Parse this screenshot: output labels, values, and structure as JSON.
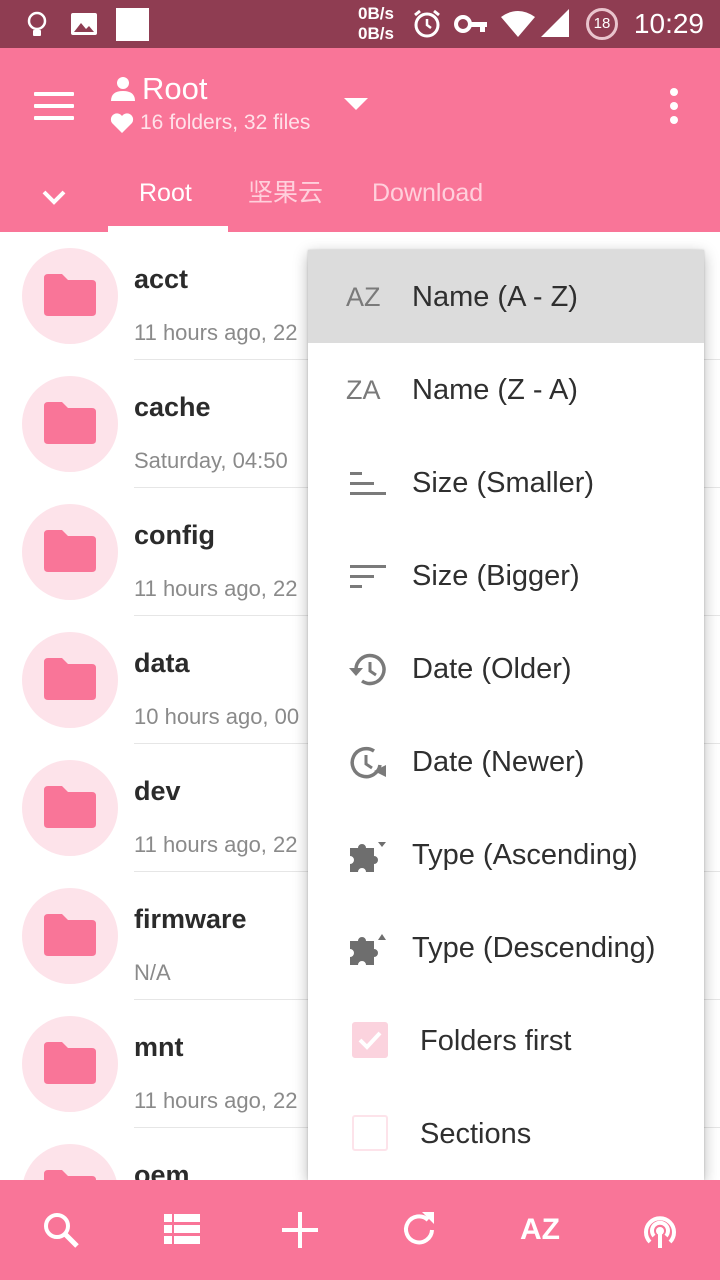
{
  "status_bar": {
    "net_up": "0B/s",
    "net_down": "0B/s",
    "notification_count": "18",
    "time": "10:29",
    "icons": [
      "lightbulb-icon",
      "image-icon",
      "blank-square-icon",
      "alarm-icon",
      "vpn-key-icon",
      "wifi-icon",
      "signal-icon"
    ]
  },
  "appbar": {
    "title": "Root",
    "subtitle": "16 folders, 32 files",
    "tabs": [
      {
        "label": "Root",
        "active": true
      },
      {
        "label": "坚果云",
        "active": false
      },
      {
        "label": "Download",
        "active": false
      }
    ]
  },
  "files": [
    {
      "name": "acct",
      "meta": "11 hours ago, 22"
    },
    {
      "name": "cache",
      "meta": "Saturday, 04:50"
    },
    {
      "name": "config",
      "meta": "11 hours ago, 22"
    },
    {
      "name": "data",
      "meta": "10 hours ago, 00"
    },
    {
      "name": "dev",
      "meta": "11 hours ago, 22"
    },
    {
      "name": "firmware",
      "meta": "N/A"
    },
    {
      "name": "mnt",
      "meta": "11 hours ago, 22"
    },
    {
      "name": "oem",
      "meta": ""
    }
  ],
  "sort_menu": {
    "items": [
      {
        "icon": "az-icon",
        "icon_text": "AZ",
        "label": "Name (A - Z)",
        "highlighted": true
      },
      {
        "icon": "za-icon",
        "icon_text": "ZA",
        "label": "Name (Z - A)"
      },
      {
        "icon": "sort-ascending-icon",
        "label": "Size (Smaller)"
      },
      {
        "icon": "sort-descending-icon",
        "label": "Size (Bigger)"
      },
      {
        "icon": "history-icon",
        "label": "Date (Older)"
      },
      {
        "icon": "clock-forward-icon",
        "label": "Date (Newer)"
      },
      {
        "icon": "puzzle-down-icon",
        "label": "Type (Ascending)"
      },
      {
        "icon": "puzzle-up-icon",
        "label": "Type (Descending)"
      }
    ],
    "checkboxes": [
      {
        "label": "Folders first",
        "checked": true
      },
      {
        "label": "Sections",
        "checked": false
      }
    ]
  },
  "bottom_bar": {
    "sort_label": "AZ",
    "icons": [
      "search-icon",
      "list-view-icon",
      "add-icon",
      "refresh-icon",
      "sort-icon",
      "cast-icon"
    ]
  },
  "colors": {
    "primary": "#f97598",
    "status_bar": "#8f3d52",
    "folder": "#f97598",
    "avatar_bg": "#fde3ea"
  }
}
